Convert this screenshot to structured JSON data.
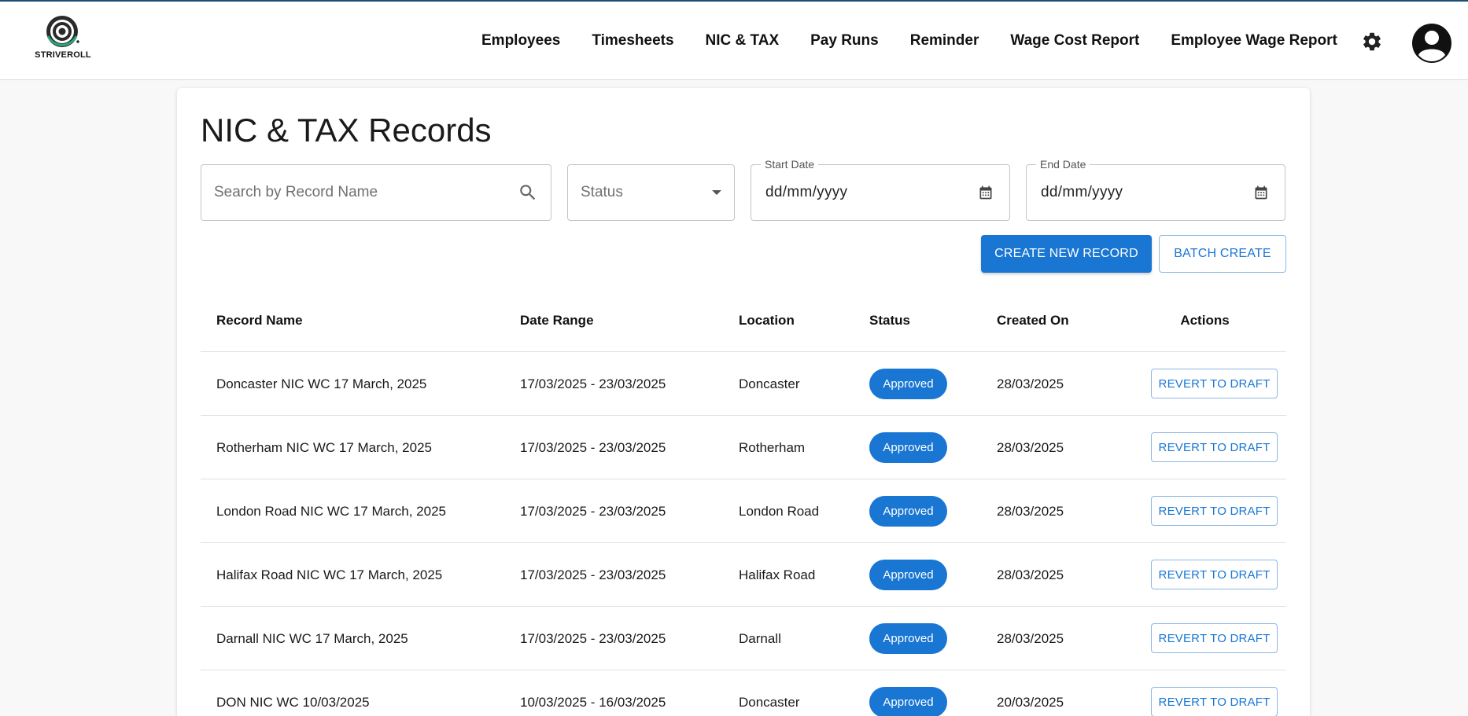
{
  "app": {
    "logo_text": "STRIVEROLL"
  },
  "nav": {
    "items": [
      "Employees",
      "Timesheets",
      "NIC & TAX",
      "Pay Runs",
      "Reminder",
      "Wage Cost Report",
      "Employee Wage Report"
    ]
  },
  "page": {
    "title": "NIC & TAX Records"
  },
  "filters": {
    "search_placeholder": "Search by Record Name",
    "status_placeholder": "Status",
    "start_date_label": "Start Date",
    "start_date_value": "dd/mm/yyyy",
    "end_date_label": "End Date",
    "end_date_value": "dd/mm/yyyy"
  },
  "actions": {
    "create_label": "CREATE NEW RECORD",
    "batch_label": "BATCH CREATE"
  },
  "table": {
    "headers": [
      "Record Name",
      "Date Range",
      "Location",
      "Status",
      "Created On",
      "Actions"
    ],
    "rows": [
      {
        "name": "Doncaster NIC WC 17 March, 2025",
        "range": "17/03/2025 - 23/03/2025",
        "location": "Doncaster",
        "status": "Approved",
        "created": "28/03/2025",
        "action": "REVERT TO DRAFT"
      },
      {
        "name": "Rotherham NIC WC 17 March, 2025",
        "range": "17/03/2025 - 23/03/2025",
        "location": "Rotherham",
        "status": "Approved",
        "created": "28/03/2025",
        "action": "REVERT TO DRAFT"
      },
      {
        "name": "London Road NIC WC 17 March, 2025",
        "range": "17/03/2025 - 23/03/2025",
        "location": "London Road",
        "status": "Approved",
        "created": "28/03/2025",
        "action": "REVERT TO DRAFT"
      },
      {
        "name": "Halifax Road NIC WC 17 March, 2025",
        "range": "17/03/2025 - 23/03/2025",
        "location": "Halifax Road",
        "status": "Approved",
        "created": "28/03/2025",
        "action": "REVERT TO DRAFT"
      },
      {
        "name": "Darnall NIC WC 17 March, 2025",
        "range": "17/03/2025 - 23/03/2025",
        "location": "Darnall",
        "status": "Approved",
        "created": "28/03/2025",
        "action": "REVERT TO DRAFT"
      },
      {
        "name": "DON NIC WC 10/03/2025",
        "range": "10/03/2025 - 16/03/2025",
        "location": "Doncaster",
        "status": "Approved",
        "created": "20/03/2025",
        "action": "REVERT TO DRAFT"
      }
    ]
  },
  "colors": {
    "primary": "#1976d2",
    "header_line": "#1d4e7a"
  }
}
